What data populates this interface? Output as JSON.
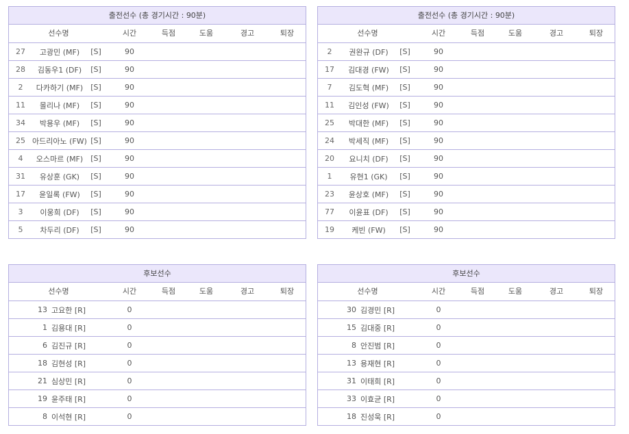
{
  "headers": [
    "선수명",
    "시간",
    "득점",
    "도움",
    "경고",
    "퇴장"
  ],
  "home_starters": {
    "title": "출전선수 (총 경기시간 : 90분)",
    "players": [
      {
        "num": "27",
        "name": "고광민 (MF)",
        "status": "[S]",
        "time": "90"
      },
      {
        "num": "28",
        "name": "김동우1 (DF)",
        "status": "[S]",
        "time": "90"
      },
      {
        "num": "2",
        "name": "다카하기 (MF)",
        "status": "[S]",
        "time": "90"
      },
      {
        "num": "11",
        "name": "몰리나 (MF)",
        "status": "[S]",
        "time": "90"
      },
      {
        "num": "34",
        "name": "박용우 (MF)",
        "status": "[S]",
        "time": "90"
      },
      {
        "num": "25",
        "name": "아드리아노 (FW)",
        "status": "[S]",
        "time": "90"
      },
      {
        "num": "4",
        "name": "오스마르 (MF)",
        "status": "[S]",
        "time": "90"
      },
      {
        "num": "31",
        "name": "유상훈 (GK)",
        "status": "[S]",
        "time": "90"
      },
      {
        "num": "17",
        "name": "윤일록 (FW)",
        "status": "[S]",
        "time": "90"
      },
      {
        "num": "3",
        "name": "이웅희 (DF)",
        "status": "[S]",
        "time": "90"
      },
      {
        "num": "5",
        "name": "차두리 (DF)",
        "status": "[S]",
        "time": "90"
      }
    ]
  },
  "away_starters": {
    "title": "출전선수 (총 경기시간 : 90분)",
    "players": [
      {
        "num": "2",
        "name": "권완규 (DF)",
        "status": "[S]",
        "time": "90"
      },
      {
        "num": "17",
        "name": "김대경 (FW)",
        "status": "[S]",
        "time": "90"
      },
      {
        "num": "7",
        "name": "김도혁 (MF)",
        "status": "[S]",
        "time": "90"
      },
      {
        "num": "11",
        "name": "김인성 (FW)",
        "status": "[S]",
        "time": "90"
      },
      {
        "num": "25",
        "name": "박대한 (MF)",
        "status": "[S]",
        "time": "90"
      },
      {
        "num": "24",
        "name": "박세직 (MF)",
        "status": "[S]",
        "time": "90"
      },
      {
        "num": "20",
        "name": "요니치 (DF)",
        "status": "[S]",
        "time": "90"
      },
      {
        "num": "1",
        "name": "유현1 (GK)",
        "status": "[S]",
        "time": "90"
      },
      {
        "num": "23",
        "name": "윤상호 (MF)",
        "status": "[S]",
        "time": "90"
      },
      {
        "num": "77",
        "name": "이윤표 (DF)",
        "status": "[S]",
        "time": "90"
      },
      {
        "num": "19",
        "name": "케빈 (FW)",
        "status": "[S]",
        "time": "90"
      }
    ]
  },
  "home_subs": {
    "title": "후보선수",
    "players": [
      {
        "num": "13",
        "name": "고요한 [R]",
        "time": "0"
      },
      {
        "num": "1",
        "name": "김용대 [R]",
        "time": "0"
      },
      {
        "num": "6",
        "name": "김진규 [R]",
        "time": "0"
      },
      {
        "num": "18",
        "name": "김현성 [R]",
        "time": "0"
      },
      {
        "num": "21",
        "name": "심상민 [R]",
        "time": "0"
      },
      {
        "num": "19",
        "name": "윤주태 [R]",
        "time": "0"
      },
      {
        "num": "8",
        "name": "이석현 [R]",
        "time": "0"
      }
    ]
  },
  "away_subs": {
    "title": "후보선수",
    "players": [
      {
        "num": "30",
        "name": "김경민 [R]",
        "time": "0"
      },
      {
        "num": "15",
        "name": "김대중 [R]",
        "time": "0"
      },
      {
        "num": "8",
        "name": "안진범 [R]",
        "time": "0"
      },
      {
        "num": "13",
        "name": "용재현 [R]",
        "time": "0"
      },
      {
        "num": "31",
        "name": "이태희 [R]",
        "time": "0"
      },
      {
        "num": "33",
        "name": "이효균 [R]",
        "time": "0"
      },
      {
        "num": "18",
        "name": "진성욱 [R]",
        "time": "0"
      }
    ]
  }
}
